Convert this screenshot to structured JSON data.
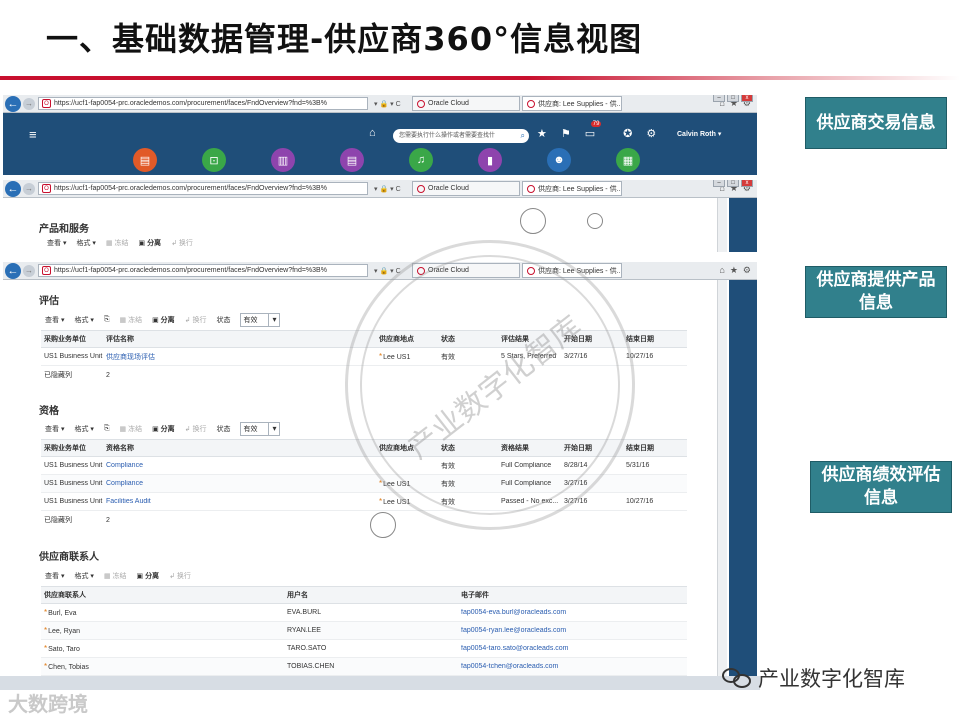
{
  "slide": {
    "title": "一、基础数据管理-供应商360°信息视图",
    "tag1": "供应商交易信息",
    "tag2": "供应商提供产品信息",
    "tag3": "供应商绩效评估信息",
    "watermark_center": "产业数字化智库",
    "watermark_bottom_left": "大数跨境",
    "watermark_bottom_right": "产业数字化智库"
  },
  "browser": {
    "url": "https://ucf1-fap0054-prc.oracledemos.com/procurement/faces/FndOverview?fnd=%3B%",
    "url_controls": "▾ 🔒 ▾ C",
    "tab_oracle": "Oracle Cloud",
    "tab_supplier": "供应商: Lee Supplies - 供...",
    "tab_close": "×",
    "win_min": "–",
    "win_max": "□",
    "win_close": "x"
  },
  "header": {
    "menu_icon": "≡",
    "home_icon": "⌂",
    "search_placeholder": "您需要执行什么操作或者需要查找什",
    "star_icon": "★",
    "flag_icon": "⚑",
    "notif_count": "79",
    "user": "Calvin Roth ▾"
  },
  "products": {
    "title": "产品和服务",
    "view": "查看 ▾",
    "format": "格式 ▾",
    "freeze": "冻结",
    "detach": "分离",
    "wrap": "换行"
  },
  "evaluation": {
    "title": "评估",
    "view": "查看 ▾",
    "format": "格式 ▾",
    "freeze": "冻结",
    "detach": "分离",
    "wrap": "换行",
    "status_label": "状态",
    "status_value": "有效",
    "columns": [
      "采购业务单位",
      "评估名称",
      "供应商地点",
      "状态",
      "评估结果",
      "开始日期",
      "结束日期"
    ],
    "rows": [
      [
        "US1 Business Unit",
        "供应商现场评估",
        "Lee US1",
        "有效",
        "5 Stars, Preferred",
        "3/27/16",
        "10/27/16"
      ]
    ],
    "footer_label": "已隐藏列",
    "footer_value": "2"
  },
  "qualification": {
    "title": "资格",
    "view": "查看 ▾",
    "format": "格式 ▾",
    "freeze": "冻结",
    "detach": "分离",
    "wrap": "换行",
    "status_label": "状态",
    "status_value": "有效",
    "columns": [
      "采购业务单位",
      "资格名称",
      "供应商地点",
      "状态",
      "资格结果",
      "开始日期",
      "结束日期"
    ],
    "rows": [
      [
        "US1 Business Unit",
        "Compliance",
        "",
        "有效",
        "Full Compliance",
        "8/28/14",
        "5/31/16"
      ],
      [
        "US1 Business Unit",
        "Compliance",
        "Lee US1",
        "有效",
        "Full Compliance",
        "3/27/16",
        ""
      ],
      [
        "US1 Business Unit",
        "Facilities Audit",
        "Lee US1",
        "有效",
        "Passed - No exc...",
        "3/27/16",
        "10/27/16"
      ]
    ],
    "footer_label": "已隐藏列",
    "footer_value": "2"
  },
  "contacts": {
    "title": "供应商联系人",
    "view": "查看 ▾",
    "format": "格式 ▾",
    "freeze": "冻结",
    "detach": "分离",
    "wrap": "换行",
    "columns": [
      "供应商联系人",
      "用户名",
      "电子邮件"
    ],
    "rows": [
      [
        "Burl, Eva",
        "EVA.BURL",
        "fap0054-eva.burl@oracleads.com"
      ],
      [
        "Lee, Ryan",
        "RYAN.LEE",
        "fap0054-ryan.lee@oracleads.com"
      ],
      [
        "Sato, Taro",
        "TARO.SATO",
        "fap0054-taro.sato@oracleads.com"
      ],
      [
        "Chen, Tobias",
        "TOBIAS.CHEN",
        "fap0054-tchen@oracleads.com"
      ]
    ]
  },
  "colors": {
    "accent_red": "#c8102e",
    "oracle_blue": "#1f4e79",
    "tag_teal": "#31808c",
    "link_blue": "#2a5db0"
  }
}
